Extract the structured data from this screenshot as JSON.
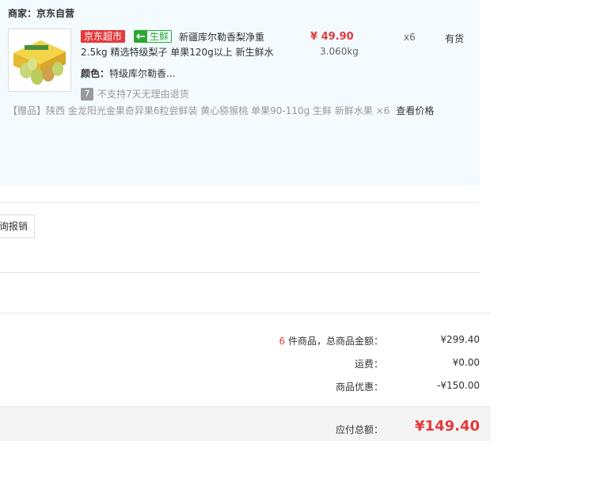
{
  "seller": {
    "label": "商家：京东自营"
  },
  "item": {
    "badge_jd": "京东超市",
    "badge_fresh": "生鲜",
    "title_line1": "新疆库尔勒香梨净重",
    "title_line2": "2.5kg 精选特级梨子 单果120g以上 新生鲜水",
    "price": "¥ 49.90",
    "weight": "3.060kg",
    "quantity": "x6",
    "stock": "有货",
    "color_label": "颜色：",
    "color_value": "特级库尔勒香...",
    "return_icon": "7",
    "return_policy": "不支持7天无理由退货",
    "colors": {
      "accent": "#e4393c",
      "fresh": "#2aa832"
    }
  },
  "gift": {
    "tag": "【赠品】",
    "text": "陕西 金龙阳光金果奇异果6粒尝鲜装 黄心猕猴桃 单果90-110g 生鲜 新鲜水果 ×6",
    "link": "查看价格"
  },
  "invoice": {
    "button_label": "询报销"
  },
  "summary": {
    "count": "6",
    "count_suffix": " 件商品，总商品金额：",
    "goods_total": "¥299.40",
    "shipping_label": "运费：",
    "shipping_value": "¥0.00",
    "discount_label": "商品优惠：",
    "discount_value": "-¥150.00",
    "payable_label": "应付总额：",
    "payable_value": "¥149.40"
  }
}
